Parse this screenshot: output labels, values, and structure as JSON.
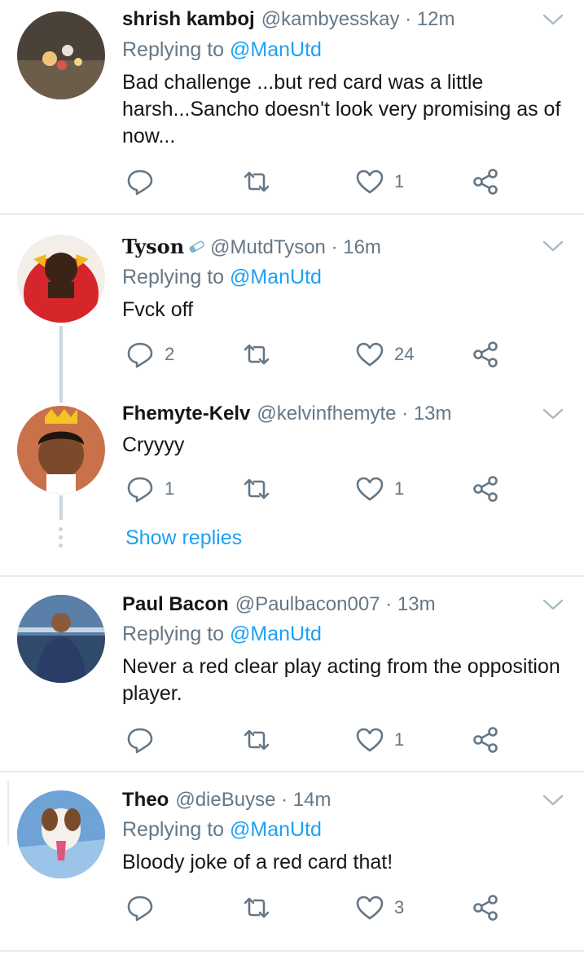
{
  "colors": {
    "accent": "#1da1f2",
    "muted": "#657786",
    "text": "#14171a",
    "divider": "#e6ecf0"
  },
  "icons": {
    "reply": "speech-bubble-icon",
    "retweet": "retweet-icon",
    "like": "heart-icon",
    "share": "share-icon",
    "menu": "chevron-down-icon"
  },
  "tweets": [
    {
      "name": "shrish kamboj",
      "handle": "@kambyesskay",
      "time": "· 12m",
      "replying_prefix": "Replying to",
      "replying_to": "@ManUtd",
      "text": "Bad challenge ...but red card was a little harsh...Sancho doesn't look very promising as of now...",
      "replies": "",
      "retweets": "",
      "likes": "1"
    },
    {
      "name": "Tyson",
      "handle": "@MutdTyson",
      "time": "· 16m",
      "replying_prefix": "Replying to",
      "replying_to": "@ManUtd",
      "text": "Fvck off",
      "replies": "2",
      "retweets": "",
      "likes": "24"
    },
    {
      "name": "Fhemyte-Kelv",
      "handle": "@kelvinfhemyte",
      "time": "· 13m",
      "text": "Cryyyy",
      "replies": "1",
      "retweets": "",
      "likes": "1"
    },
    {
      "name": "Paul Bacon",
      "handle": "@Paulbacon007",
      "time": "· 13m",
      "replying_prefix": "Replying to",
      "replying_to": "@ManUtd",
      "text": "Never a red clear play acting from the opposition player.",
      "replies": "",
      "retweets": "",
      "likes": "1"
    },
    {
      "name": "Theo",
      "handle": "@dieBuyse",
      "time": "· 14m",
      "replying_prefix": "Replying to",
      "replying_to": "@ManUtd",
      "text": "Bloody joke of a red card that!",
      "replies": "",
      "retweets": "",
      "likes": "3"
    }
  ],
  "show_replies": "Show replies"
}
